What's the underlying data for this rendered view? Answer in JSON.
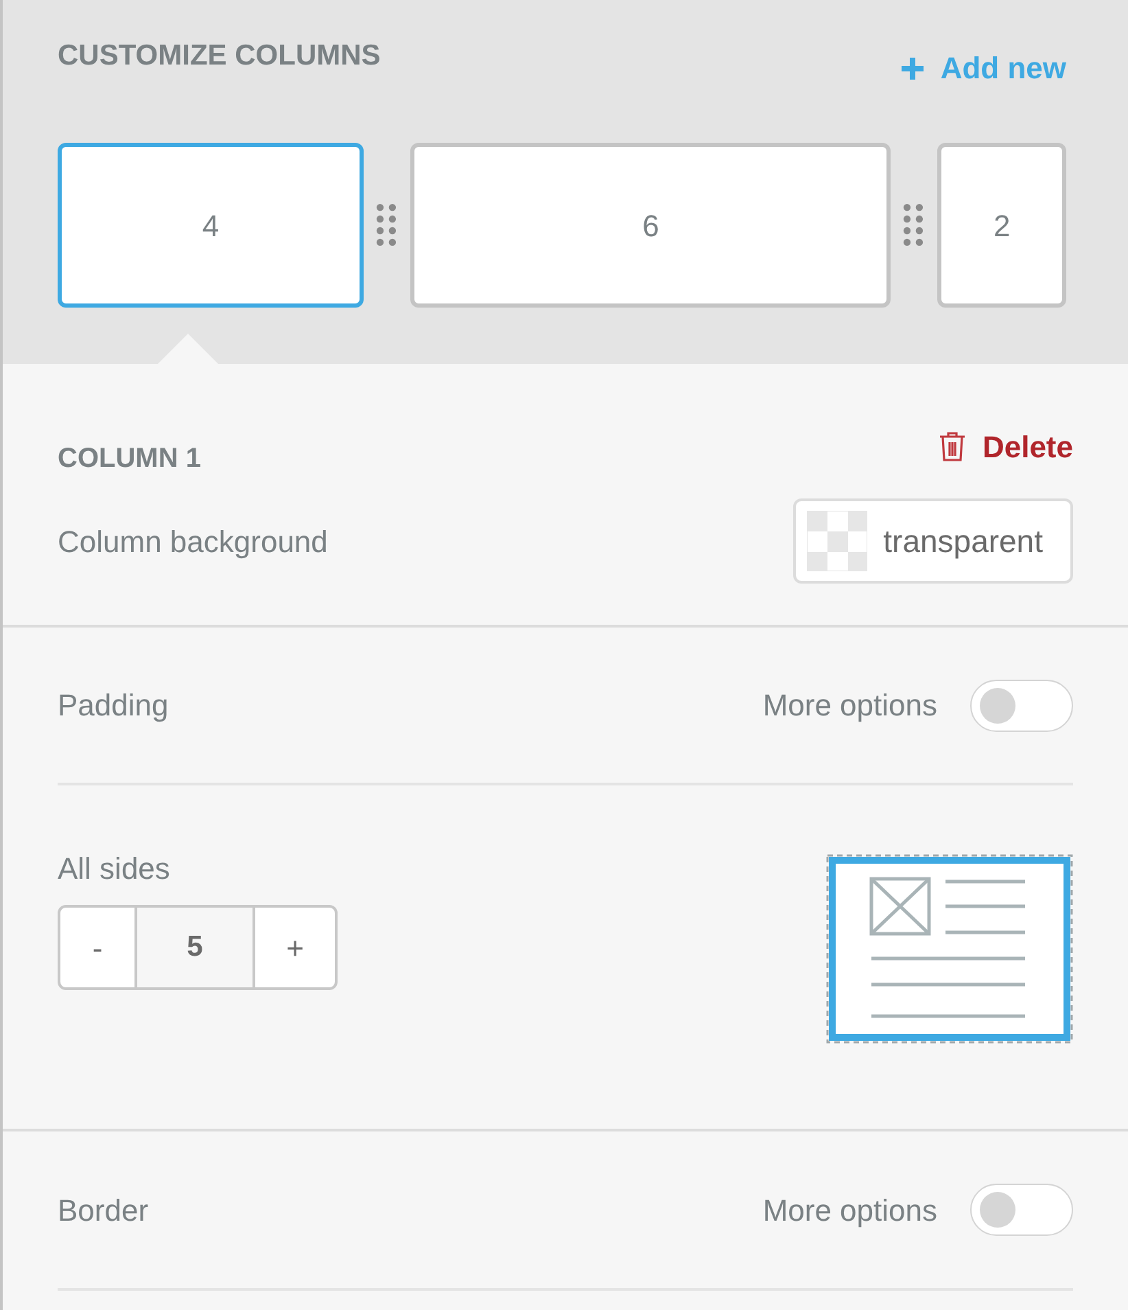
{
  "header": {
    "title": "CUSTOMIZE COLUMNS",
    "add_label": "Add new"
  },
  "columns": [
    {
      "label": "4",
      "selected": true
    },
    {
      "label": "6",
      "selected": false
    },
    {
      "label": "2",
      "selected": false
    }
  ],
  "column_settings": {
    "title": "COLUMN 1",
    "delete_label": "Delete",
    "background_label": "Column background",
    "background_value": "transparent"
  },
  "padding": {
    "label": "Padding",
    "more_options_label": "More options",
    "more_options_on": false,
    "all_sides_label": "All sides",
    "minus": "-",
    "value": "5",
    "plus": "+"
  },
  "border": {
    "label": "Border",
    "more_options_label": "More options",
    "more_options_on": false
  }
}
